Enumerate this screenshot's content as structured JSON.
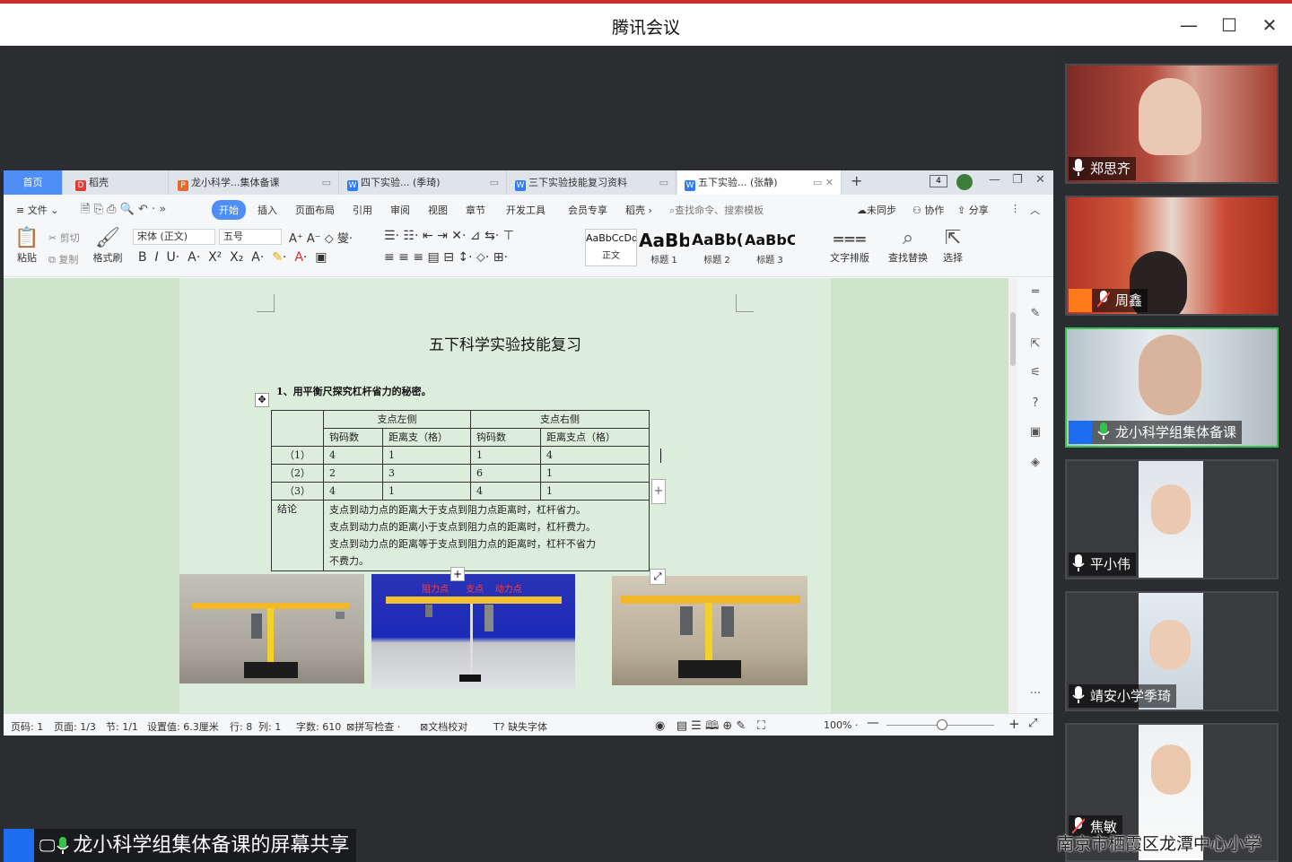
{
  "window": {
    "title": "腾讯会议"
  },
  "wps": {
    "tabs": [
      {
        "label": "首页"
      },
      {
        "label": "稻壳"
      },
      {
        "label": "龙小科学...集体备课"
      },
      {
        "label": "四下实验... (季琦)"
      },
      {
        "label": "三下实验技能复习资料"
      },
      {
        "label": "五下实验... (张静)"
      }
    ],
    "menus": [
      "文件",
      "开始",
      "插入",
      "页面布局",
      "引用",
      "审阅",
      "视图",
      "章节",
      "开发工具",
      "会员专享",
      "稻壳"
    ],
    "search_placeholder": "查找命令、搜索模板",
    "sync": "未同步",
    "collab": "协作",
    "share": "分享",
    "ribbon": {
      "paste": "粘贴",
      "cut": "剪切",
      "copy": "复制",
      "format_painter": "格式刷",
      "font_name": "宋体 (正文)",
      "font_size": "五号",
      "styles": [
        {
          "preview": "AaBbCcDd",
          "label": "正文"
        },
        {
          "preview": "AaBb",
          "label": "标题 1"
        },
        {
          "preview": "AaBb(",
          "label": "标题 2"
        },
        {
          "preview": "AaBbC",
          "label": "标题 3"
        }
      ],
      "text_layout": "文字排版",
      "find_replace": "查找替换",
      "select": "选择"
    },
    "document": {
      "title": "五下科学实验技能复习",
      "question": "1、用平衡尺探究杠杆省力的秘密。",
      "table": {
        "group_left": "支点左侧",
        "group_right": "支点右侧",
        "sub_headers": [
          "钩码数",
          "距离支（格）",
          "钩码数",
          "距离支点（格）"
        ],
        "rows": [
          {
            "label": "（1）",
            "cells": [
              "4",
              "1",
              "1",
              "4"
            ]
          },
          {
            "label": "（2）",
            "cells": [
              "2",
              "3",
              "6",
              "1"
            ]
          },
          {
            "label": "（3）",
            "cells": [
              "4",
              "1",
              "4",
              "1"
            ]
          }
        ],
        "conclusion_label": "结论",
        "conclusion_lines": [
          "支点到动力点的距离大于支点到阻力点距离时，杠杆省力。",
          "支点到动力点的距离小于支点到阻力点的距离时，杠杆费力。",
          "支点到动力点的距离等于支点到阻力点的距离时，杠杆不省力",
          "不费力。"
        ]
      },
      "photo_labels": [
        "阻力点",
        "支点",
        "动力点"
      ]
    },
    "status": {
      "page_no": "页码: 1",
      "pages": "页面: 1/3",
      "section": "节: 1/1",
      "setting": "设置值: 6.3厘米",
      "row": "行: 8",
      "col": "列: 1",
      "words": "字数: 610",
      "spell": "拼写检查",
      "proof": "文档校对",
      "missing_font": "缺失字体",
      "zoom": "100%"
    }
  },
  "participants": [
    {
      "name": "郑思齐"
    },
    {
      "name": "周鑫"
    },
    {
      "name": "龙小科学组集体备课"
    },
    {
      "name": "平小伟"
    },
    {
      "name": "靖安小学季琦"
    },
    {
      "name": "焦敏"
    }
  ],
  "share_label": "龙小科学组集体备课的屏幕共享",
  "watermark": "南京市栖霞区龙潭中心小学",
  "colors": {
    "accent": "#4f8ef7",
    "active_speaker": "#35c34a",
    "title_bar_top": "#c9302c"
  }
}
